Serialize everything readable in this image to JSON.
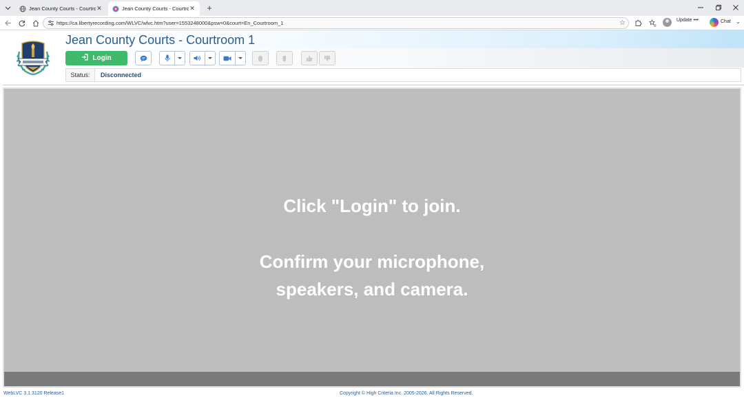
{
  "browser": {
    "tabs": [
      {
        "title": "Jean County Courts - Courtroom 1",
        "active": false
      },
      {
        "title": "Jean County Courts - Courtroom 1",
        "active": true
      }
    ],
    "url": "https://ca.libertyrecording.com/WLVC/wlvc.htm?user=1553248000&psw=0&court=En_Courtroom_1",
    "update_label": "Update •••",
    "chat_label": "Chat",
    "icons": {
      "tab_list": "chevron-down-icon",
      "globe": "globe-icon",
      "back": "arrow-left-icon",
      "refresh": "refresh-icon",
      "home": "home-icon",
      "site_info": "tune-icon",
      "favorite": "star-icon",
      "extensions": "puzzle-icon",
      "favorites": "star-list-icon"
    }
  },
  "app": {
    "title": "Jean County Courts - Courtroom 1",
    "login_label": "Login",
    "status_label": "Status:",
    "status_value": "Disconnected",
    "message": {
      "line1": "Click \"Login\" to join.",
      "line2": "Confirm your microphone,",
      "line3": "speakers, and camera."
    },
    "colors": {
      "accent": "#2a5d8e",
      "login": "#3fba6c",
      "panel": "#bdbdbd",
      "panel_footer": "#7a7a7a"
    }
  },
  "footer": {
    "version": "WebLVC 3.1.3120 Release1",
    "copyright": "Copyright © High Criteria Inc. 2005-2026. All Rights Reserved."
  }
}
